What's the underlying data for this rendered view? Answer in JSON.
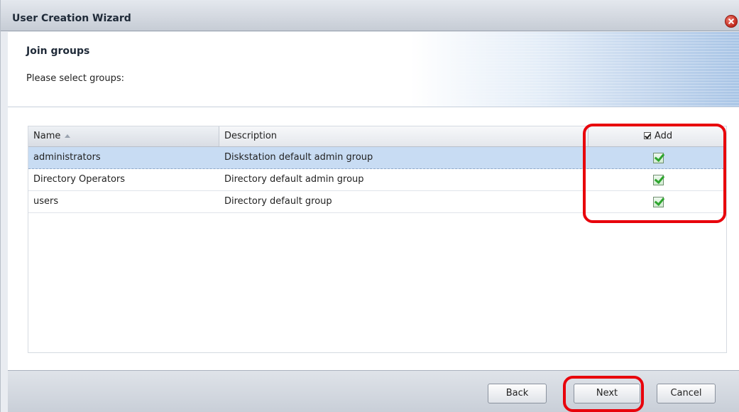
{
  "window": {
    "title": "User Creation Wizard",
    "close_icon": "close-icon"
  },
  "step": {
    "title": "Join groups",
    "subtitle": "Please select groups:"
  },
  "grid": {
    "columns": {
      "name": "Name",
      "description": "Description",
      "add": "Add"
    },
    "sort": {
      "column": "name",
      "direction": "ascending"
    },
    "header_add_checked": true,
    "rows": [
      {
        "name": "administrators",
        "description": "Diskstation default admin group",
        "add": true,
        "selected": true
      },
      {
        "name": "Directory Operators",
        "description": "Directory default admin group",
        "add": true,
        "selected": false
      },
      {
        "name": "users",
        "description": "Directory default group",
        "add": true,
        "selected": false
      }
    ]
  },
  "footer": {
    "back_label": "Back",
    "next_label": "Next",
    "cancel_label": "Cancel"
  },
  "colors": {
    "annotation": "#e8000b",
    "selected_row": "#c8dcf3",
    "check_green": "#2ea52e"
  }
}
